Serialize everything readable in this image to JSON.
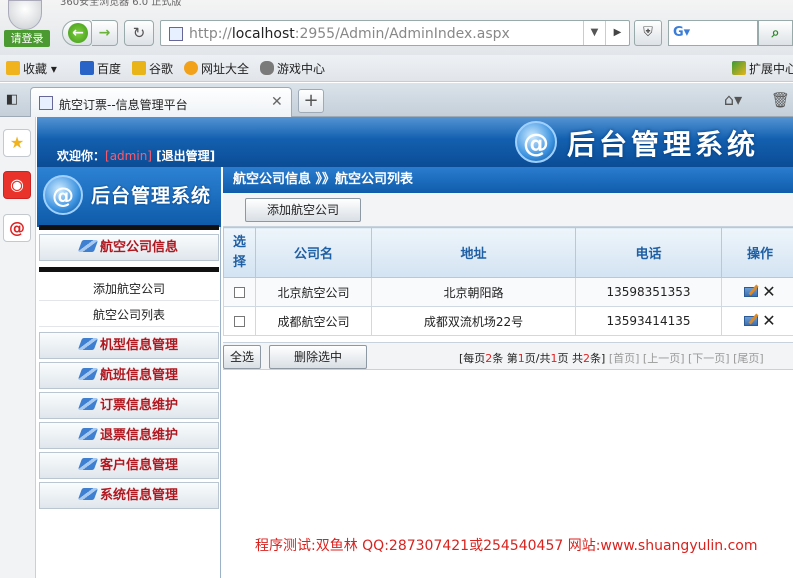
{
  "browser": {
    "top_tab_title": "360安全浏览器 6.0 正式版",
    "login_label": "请登录",
    "url_prefix": "http://",
    "url_host": "localhost",
    "url_rest": ":2955/Admin/AdminIndex.aspx",
    "favorites_label": "收藏",
    "favorites": [
      {
        "label": "百度",
        "color": "#2a63c7"
      },
      {
        "label": "谷歌",
        "color": "#e8b418"
      },
      {
        "label": "网址大全",
        "color": "#f2a11a"
      },
      {
        "label": "游戏中心",
        "color": "#7a7a7a"
      }
    ],
    "extend_label": "扩展中心",
    "tab_title": "航空订票--信息管理平台"
  },
  "header": {
    "welcome": "欢迎你：",
    "username": "[admin]",
    "logout": "[退出管理]",
    "title": "后台管理系统"
  },
  "sidebar": {
    "title": "后台管理系统",
    "airline_menu": "航空公司信息",
    "sub_items": [
      "添加航空公司",
      "航空公司列表"
    ],
    "menus": [
      "机型信息管理",
      "航班信息管理",
      "订票信息维护",
      "退票信息维护",
      "客户信息管理",
      "系统信息管理"
    ]
  },
  "main": {
    "breadcrumb": "航空公司信息 》》航空公司列表",
    "add_button": "添加航空公司",
    "columns": [
      "选择",
      "公司名",
      "地址",
      "电话",
      "操作"
    ],
    "rows": [
      {
        "name": "北京航空公司",
        "address": "北京朝阳路",
        "phone": "13598351353"
      },
      {
        "name": "成都航空公司",
        "address": "成都双流机场22号",
        "phone": "13593414135"
      }
    ],
    "select_all": "全选",
    "delete_selected": "删除选中",
    "pager": {
      "per_page_prefix": "[每页",
      "per_page": "2",
      "per_page_suffix": "条 第",
      "current": "1",
      "sep": "页/共",
      "total_pages": "1",
      "total_prefix": "页 共",
      "total_items": "2",
      "total_suffix": "条]",
      "first": "[首页]",
      "prev": "[上一页]",
      "next": "[下一页]",
      "last": "[尾页]"
    }
  },
  "credit": "程序测试:双鱼林  QQ:287307421或254540457 网站:www.shuangyulin.com"
}
